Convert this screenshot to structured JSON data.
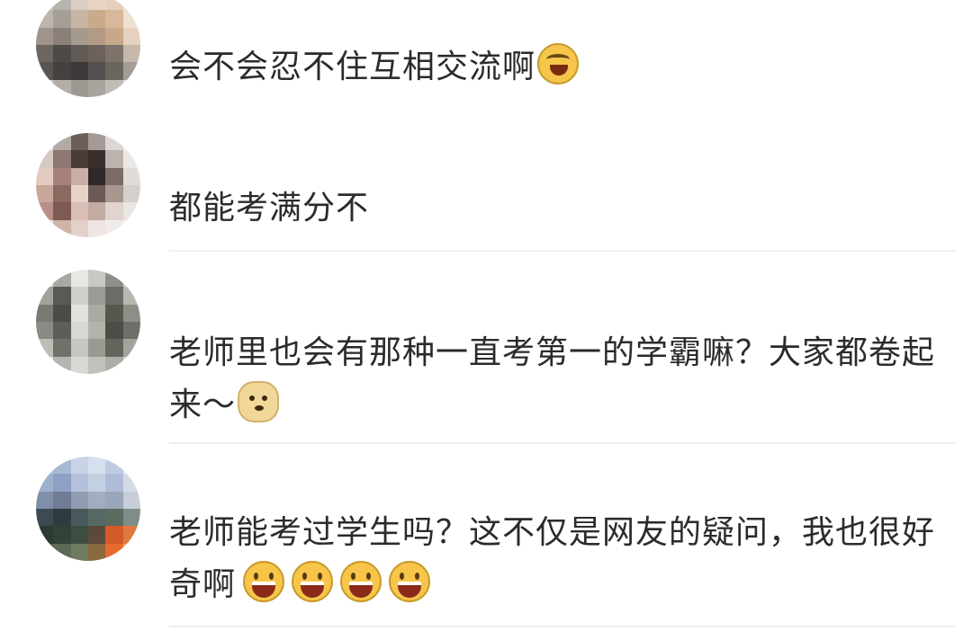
{
  "comments": [
    {
      "text": "会不会忍不住互相交流啊",
      "emoji": "laugh-cry-icon",
      "avatar_colors": [
        "#c9c6c2",
        "#b7b3ad",
        "#d8cec4",
        "#e8d4c2",
        "#e6d0bb",
        "#f2e3d6",
        "#bdb6ae",
        "#a59f98",
        "#c8b5a3",
        "#c9ab8c",
        "#d7b89b",
        "#eee0d2",
        "#9e948b",
        "#8a8079",
        "#a49a8f",
        "#b39a85",
        "#c8a88a",
        "#e5d1bf",
        "#6d6560",
        "#4e4a47",
        "#615a55",
        "#6c625b",
        "#7e736a",
        "#c6b8ab",
        "#5a5552",
        "#444140",
        "#3c3a39",
        "#545050",
        "#6b6560",
        "#a49c96",
        "#d2ccc7",
        "#b5ada7",
        "#9e9893",
        "#aaa49f",
        "#c2bcb7",
        "#e4dfdb"
      ]
    },
    {
      "text": "都能考满分不",
      "emoji": "",
      "avatar_colors": [
        "#e9e6e4",
        "#b3a9a5",
        "#6b5d5a",
        "#a49b97",
        "#dcd7d4",
        "#f3f1ef",
        "#d8c9c3",
        "#8d7770",
        "#4a3b37",
        "#3a2f2d",
        "#bdb3ae",
        "#ece8e6",
        "#e3cbc2",
        "#a58378",
        "#c8aea5",
        "#2f2826",
        "#7b6c67",
        "#e1dcd9",
        "#caa79b",
        "#8b6a61",
        "#e7d2ca",
        "#6b5a55",
        "#a8968f",
        "#d6d0cc",
        "#b99087",
        "#7d5a52",
        "#d9bfb6",
        "#c2aba3",
        "#e0d4cf",
        "#eae6e3",
        "#e8dcd7",
        "#cfb2a8",
        "#e4d0c9",
        "#efe6e2",
        "#f1ece9",
        "#f5f3f1"
      ]
    },
    {
      "text": "老师里也会有那种一直考第一的学霸嘛？大家都卷起来～",
      "emoji": "doge-icon",
      "avatar_colors": [
        "#dcdcd8",
        "#a9a8a2",
        "#e8e7e3",
        "#c9c8c3",
        "#8f8e88",
        "#d2d1cc",
        "#a3a29b",
        "#5a5954",
        "#cfcec9",
        "#9c9b95",
        "#6c6b66",
        "#b8b7b1",
        "#7a7a73",
        "#4b4b46",
        "#e2e1dc",
        "#aaa9a2",
        "#57564f",
        "#8e8d86",
        "#8b8a84",
        "#5e5d57",
        "#d8d7d2",
        "#b3b2ab",
        "#4d4c46",
        "#6f6e68",
        "#bdbcb6",
        "#727169",
        "#c6c5bf",
        "#9a9992",
        "#64635c",
        "#a4a39d",
        "#e4e3df",
        "#b6b5af",
        "#d9d8d3",
        "#c1c0ba",
        "#aeada7",
        "#d5d4cf"
      ]
    },
    {
      "text": "老师能考过学生吗？这不仅是网友的疑问，我也很好奇啊",
      "emoji": "grin-icon",
      "emoji_count": 4,
      "avatar_colors": [
        "#b8c6de",
        "#a9b8d3",
        "#c8d3e6",
        "#d6dfee",
        "#bfcbe1",
        "#e3e9f3",
        "#9fb0cf",
        "#8ea1c4",
        "#b3c1da",
        "#c3cfe3",
        "#aebcd7",
        "#d3dbe9",
        "#7f8ea9",
        "#6f7c93",
        "#8f9cb2",
        "#a3adbf",
        "#9aa6ba",
        "#c7ced9",
        "#3c4a52",
        "#2f3b3f",
        "#4a5a5c",
        "#556a63",
        "#5a6b60",
        "#7f8d8a",
        "#2c3a33",
        "#324238",
        "#3d4d40",
        "#5b4a3a",
        "#d45a2a",
        "#e07a3c",
        "#4d5a4a",
        "#5e6b54",
        "#6f7b5e",
        "#8a6a3e",
        "#e8692e",
        "#f0a05a"
      ]
    }
  ],
  "colors": {
    "text": "#2b2b2b",
    "divider": "#efefef",
    "background": "#ffffff"
  }
}
